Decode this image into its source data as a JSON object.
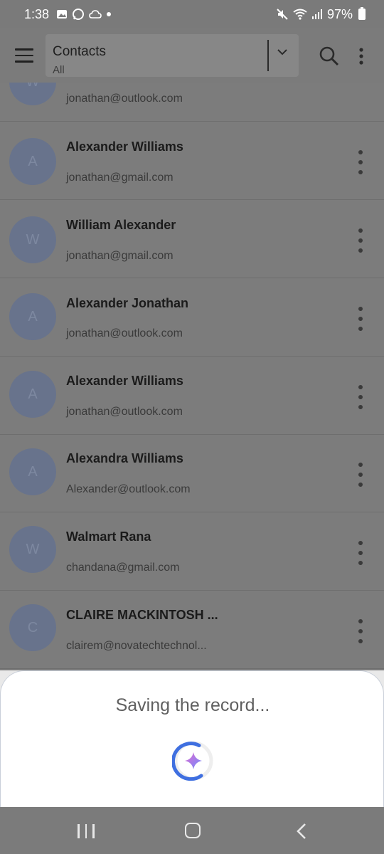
{
  "status_bar": {
    "time": "1:38",
    "battery": "97%",
    "icons": [
      "gallery-icon",
      "whatsapp-icon",
      "cloud-icon",
      "dot-icon",
      "mute-icon",
      "wifi-icon",
      "signal-icon",
      "battery-icon"
    ]
  },
  "app_bar": {
    "title": "Contacts",
    "filter": "All",
    "icons": [
      "menu-icon",
      "chevron-down-icon",
      "search-icon",
      "more-vert-icon"
    ]
  },
  "contacts": [
    {
      "initial": "W",
      "name": "",
      "email": "jonathan@outlook.com"
    },
    {
      "initial": "A",
      "name": "Alexander Williams",
      "email": "jonathan@gmail.com"
    },
    {
      "initial": "W",
      "name": "William Alexander",
      "email": "jonathan@gmail.com"
    },
    {
      "initial": "A",
      "name": "Alexander Jonathan",
      "email": "jonathan@outlook.com"
    },
    {
      "initial": "A",
      "name": "Alexander Williams",
      "email": "jonathan@outlook.com"
    },
    {
      "initial": "A",
      "name": "Alexandra Williams",
      "email": "Alexander@outlook.com"
    },
    {
      "initial": "W",
      "name": "Walmart Rana",
      "email": "chandana@gmail.com"
    },
    {
      "initial": "C",
      "name": "CLAIRE MACKINTOSH ...",
      "email": "clairem@novatechtechnol..."
    }
  ],
  "sheet": {
    "message": "Saving the record...",
    "icon": "sparkle-loader-icon"
  },
  "nav_bar": {
    "icons": [
      "recent-apps-icon",
      "home-icon",
      "back-icon"
    ]
  },
  "colors": {
    "scrim": "#7c7c7c",
    "avatar": "#68738c",
    "loader_blue": "#3f6fe0",
    "sparkle_start": "#e06bd0",
    "sparkle_end": "#6f8cff"
  }
}
